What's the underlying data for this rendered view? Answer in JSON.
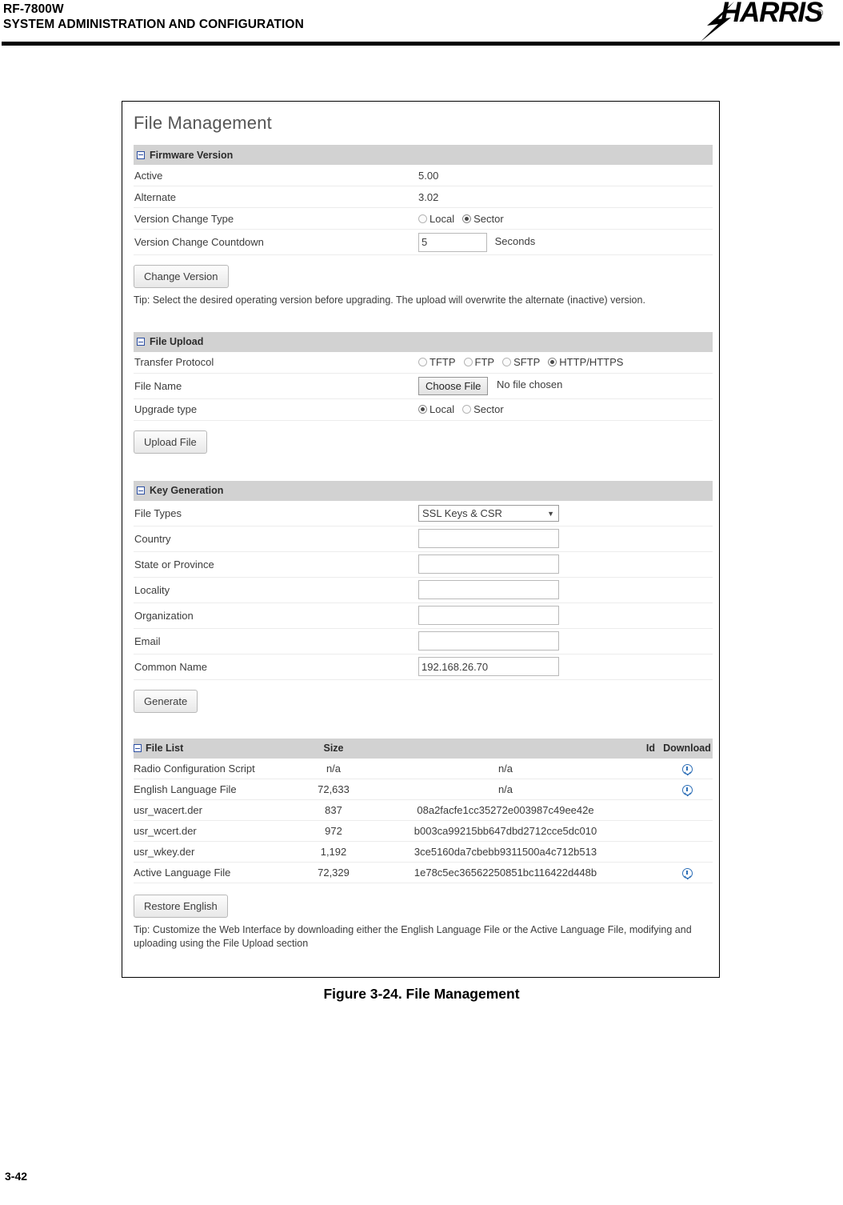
{
  "document": {
    "header_title_line1": "RF-7800W",
    "header_title_line2": "SYSTEM ADMINISTRATION AND CONFIGURATION",
    "brand": "HARRIS",
    "brand_registered": "®",
    "figure_caption": "Figure 3-24.  File Management",
    "page_number": "3-42"
  },
  "panel": {
    "title": "File Management"
  },
  "firmware_version": {
    "header": "Firmware Version",
    "active_label": "Active",
    "active_value": "5.00",
    "alternate_label": "Alternate",
    "alternate_value": "3.02",
    "change_type_label": "Version Change Type",
    "change_type_options": [
      "Local",
      "Sector"
    ],
    "change_type_selected": "Sector",
    "countdown_label": "Version Change Countdown",
    "countdown_value": "5",
    "countdown_unit": "Seconds",
    "change_button": "Change Version",
    "tip": "Tip: Select the desired operating version before upgrading. The upload will overwrite the alternate (inactive) version."
  },
  "file_upload": {
    "header": "File Upload",
    "protocol_label": "Transfer Protocol",
    "protocol_options": [
      "TFTP",
      "FTP",
      "SFTP",
      "HTTP/HTTPS"
    ],
    "protocol_selected": "HTTP/HTTPS",
    "file_name_label": "File Name",
    "choose_file_button": "Choose File",
    "file_status": "No file chosen",
    "upgrade_type_label": "Upgrade type",
    "upgrade_type_options": [
      "Local",
      "Sector"
    ],
    "upgrade_type_selected": "Local",
    "upload_button": "Upload File"
  },
  "key_generation": {
    "header": "Key Generation",
    "file_types_label": "File Types",
    "file_types_value": "SSL Keys & CSR",
    "country_label": "Country",
    "country_value": "",
    "state_label": "State or Province",
    "state_value": "",
    "locality_label": "Locality",
    "locality_value": "",
    "organization_label": "Organization",
    "organization_value": "",
    "email_label": "Email",
    "email_value": "",
    "common_name_label": "Common Name",
    "common_name_value": "192.168.26.70",
    "generate_button": "Generate"
  },
  "file_list": {
    "header": "File List",
    "columns": {
      "name": "File List",
      "size": "Size",
      "id": "Id",
      "download": "Download"
    },
    "rows": [
      {
        "name": "Radio Configuration Script",
        "size": "n/a",
        "id": "n/a",
        "download": true
      },
      {
        "name": "English Language File",
        "size": "72,633",
        "id": "n/a",
        "download": true
      },
      {
        "name": "usr_wacert.der",
        "size": "837",
        "id": "08a2facfe1cc35272e003987c49ee42e",
        "download": false
      },
      {
        "name": "usr_wcert.der",
        "size": "972",
        "id": "b003ca99215bb647dbd2712cce5dc010",
        "download": false
      },
      {
        "name": "usr_wkey.der",
        "size": "1,192",
        "id": "3ce5160da7cbebb9311500a4c712b513",
        "download": false
      },
      {
        "name": "Active Language File",
        "size": "72,329",
        "id": "1e78c5ec36562250851bc116422d448b",
        "download": true
      }
    ],
    "restore_button": "Restore English",
    "tip": "Tip: Customize the Web Interface by downloading either the English Language File or the Active Language File, modifying and uploading using the File Upload section"
  },
  "colors": {
    "section_header_bg": "#d2d2d2",
    "download_icon": "#2d6fb7",
    "collapse_icon": "#2b4ea2"
  }
}
